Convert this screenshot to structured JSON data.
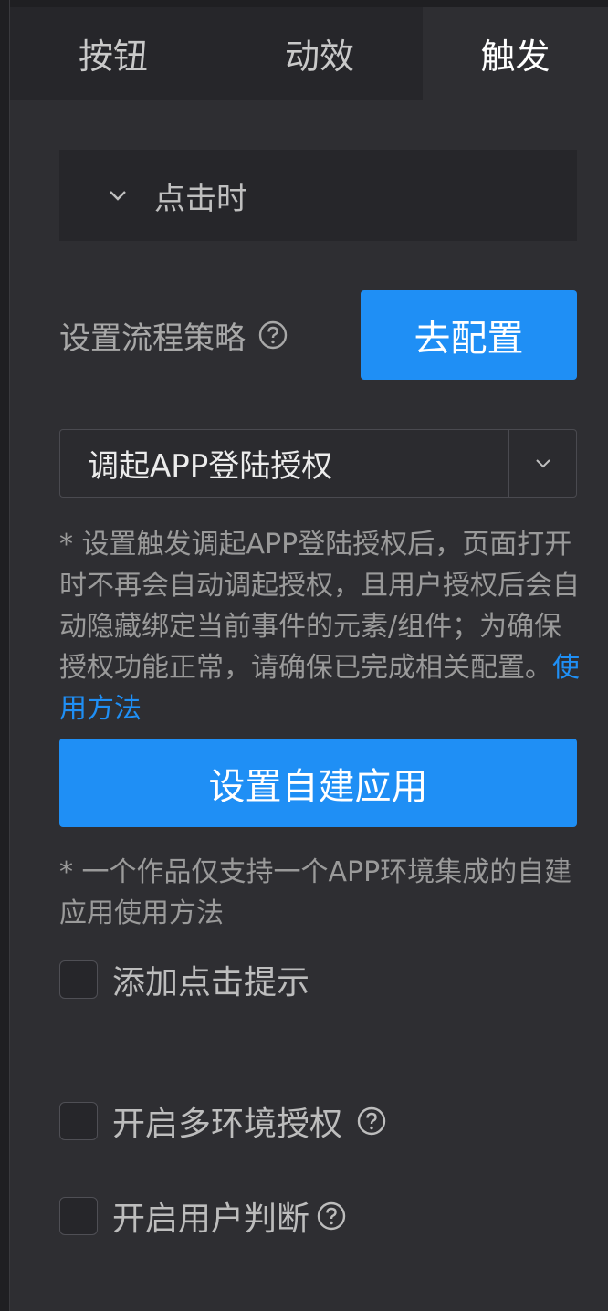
{
  "tabs": [
    {
      "label": "按钮",
      "active": false
    },
    {
      "label": "动效",
      "active": false
    },
    {
      "label": "触发",
      "active": true
    }
  ],
  "section": {
    "title": "点击时",
    "icon": "chevron-down-icon"
  },
  "flow": {
    "label": "设置流程策略",
    "help_icon": "question-circle-icon",
    "button": "去配置"
  },
  "select": {
    "value": "调起APP登陆授权",
    "icon": "chevron-down-icon"
  },
  "note1": {
    "text": "* 设置触发调起APP登陆授权后，页面打开时不再会自动调起授权，且用户授权后会自动隐藏绑定当前事件的元素/组件；为确保授权功能正常，请确保已完成相关配置。",
    "link": "使用方法"
  },
  "app_button": "设置自建应用",
  "note2": {
    "text": "* 一个作品仅支持一个APP环境集成的自建应用使用方法"
  },
  "checkboxes": [
    {
      "label": "添加点击提示",
      "checked": false,
      "help": false
    },
    {
      "label": "开启多环境授权",
      "checked": false,
      "help": true
    },
    {
      "label": "开启用户判断",
      "checked": false,
      "help": true
    }
  ],
  "colors": {
    "accent": "#1f8ff5",
    "background": "#2e2e32",
    "panel": "#26262a"
  }
}
